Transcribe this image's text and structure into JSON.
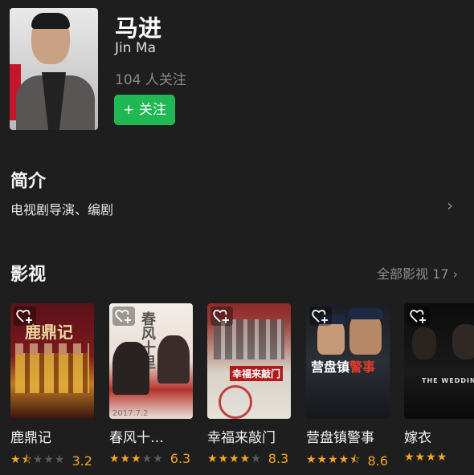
{
  "person": {
    "name_cn": "马进",
    "name_en": "Jin Ma",
    "followers": "104 人关注",
    "follow_button": "+ 关注"
  },
  "intro": {
    "heading": "简介",
    "text": "电视剧导演、编剧"
  },
  "works": {
    "heading": "影视",
    "all_link": "全部影视 17",
    "items": [
      {
        "title": "鹿鼎记",
        "poster_text": "鹿鼎记",
        "rating": "3.2",
        "stars": 1.5
      },
      {
        "title": "春风十…",
        "poster_text": "春风十里",
        "poster_caption": "2017.7.2",
        "rating": "6.3",
        "stars": 3
      },
      {
        "title": "幸福来敲门",
        "poster_text": "幸福来敲门",
        "rating": "8.3",
        "stars": 4
      },
      {
        "title": "营盘镇警事",
        "poster_text": "营盘镇警事",
        "rating": "8.6",
        "stars": 4.5
      },
      {
        "title": "嫁衣",
        "poster_text": "THE WEDDING",
        "rating": "",
        "stars": 4
      }
    ]
  },
  "colors": {
    "background": "#1e1e1e",
    "accent_green": "#20b853",
    "star": "#f5a623"
  },
  "icons": {
    "favorite": "heart-plus-icon",
    "chevron": "chevron-right-icon"
  }
}
